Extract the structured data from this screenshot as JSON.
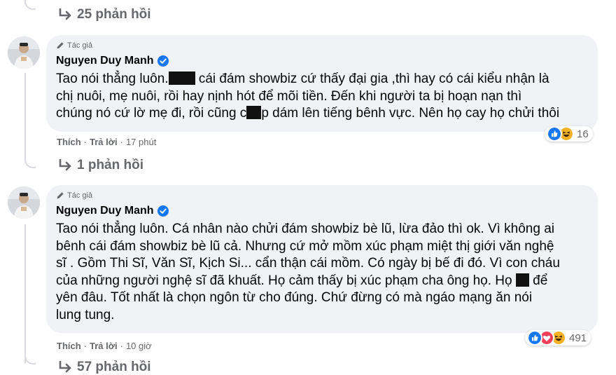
{
  "thread": [
    {
      "replies_label": "25 phản hồi"
    }
  ],
  "comments": [
    {
      "author_tag": "Tác giả",
      "author_name": "Nguyen Duy Manh",
      "lines": [
        [
          "Tao nói thẳng luôn.",
          "",
          " cái đám showbiz cứ thấy đại gia ,thì hay có cái kiểu nhận là"
        ],
        [
          "chị nuôi, mẹ nuôi, rồi hay nịnh hót để mõi tiền. Đến khi người ta bị hoạn nạn thì"
        ],
        [
          "chúng nó cứ lờ mẹ đi, rồi cũng c",
          "",
          "p dám lên tiếng bênh vực. Nên họ cay họ chửi thôi"
        ]
      ],
      "reaction_count": "16",
      "like_label": "Thích",
      "reply_label": "Trả lời",
      "time": "17 phút",
      "replies_label": "1 phản hồi"
    },
    {
      "author_tag": "Tác giả",
      "author_name": "Nguyen Duy Manh",
      "lines": [
        [
          "Tao nói thẳng luôn. Cá nhân nào chửi đám showbiz bè lũ, lừa đảo thì ok. Vì không ai"
        ],
        [
          "bênh cái đám showbiz bè lũ cả. Nhưng cứ mở mồm xúc phạm miệt thị giới văn nghệ"
        ],
        [
          "sĩ . Gồm Thi Sĩ, Văn Sĩ, Kịch Si... cẩn thận cái mồm. Có ngày bị bế đi đó. Vì con cháu"
        ],
        [
          "của những người nghệ sĩ đã khuất. Họ cảm thấy bị xúc phạm cha ông họ. Họ ",
          "",
          " để"
        ],
        [
          "yên đâu. Tốt nhất là chọn ngôn từ cho đúng. Chứ đừng có mà ngáo mạng ăn nói"
        ],
        [
          "lung tung."
        ]
      ],
      "reaction_count": "491",
      "like_label": "Thích",
      "reply_label": "Trả lời",
      "time": "10 giờ",
      "replies_label": "57 phản hồi"
    }
  ],
  "icons": {
    "reply_arrow": "reply-arrow-icon",
    "author_badge": "pencil-icon",
    "verified": "verified-badge-icon",
    "like": "like-reaction-icon",
    "haha": "haha-reaction-icon",
    "love": "love-reaction-icon"
  },
  "colors": {
    "bubble_bg": "#f0f2f5",
    "secondary_text": "#65676b",
    "verified_blue": "#1877f2",
    "censor_black": "#111111"
  }
}
